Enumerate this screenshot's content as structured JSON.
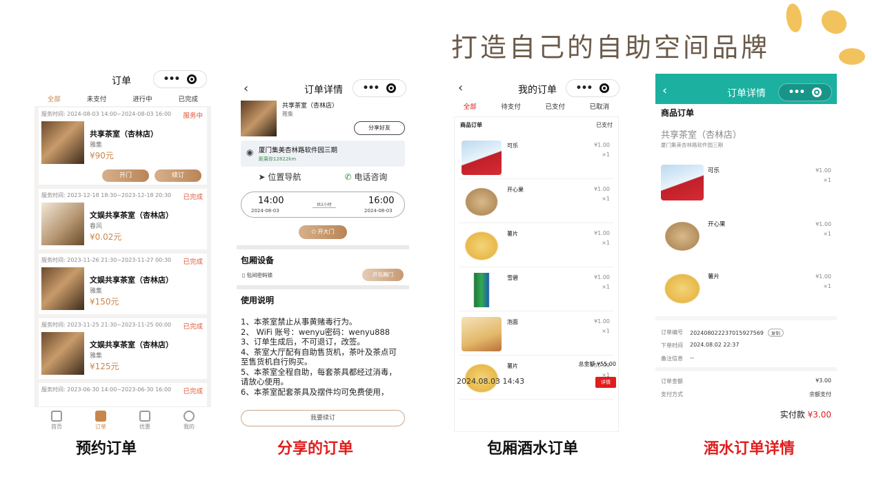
{
  "slogan": "打造自己的自助空间品牌",
  "captions": [
    "预约订单",
    "分享的订单",
    "包厢酒水订单",
    "酒水订单详情"
  ],
  "accent_colors": {
    "brand_gold": "#c8864c",
    "red": "#e11d1d",
    "teal": "#1bb0a0"
  },
  "screen1": {
    "title": "订单",
    "tabs": [
      "全部",
      "未支付",
      "进行中",
      "已完成"
    ],
    "orders": [
      {
        "time": "服务时间: 2024-08-03 14:00~2024-08-03 16:00",
        "status": "服务中",
        "name": "共享茶室（杏林店）",
        "room": "雅集",
        "price": "¥90元",
        "buttons": [
          "开门",
          "续订"
        ]
      },
      {
        "time": "服务时间: 2023-12-18 18:30~2023-12-18 20:30",
        "status": "已完成",
        "name": "文娱共享茶室（杏林店）",
        "room": "春风",
        "price": "¥0.02元"
      },
      {
        "time": "服务时间: 2023-11-26 21:30~2023-11-27 00:30",
        "status": "已完成",
        "name": "文娱共享茶室（杏林店）",
        "room": "雅集",
        "price": "¥150元"
      },
      {
        "time": "服务时间: 2023-11-25 21:30~2023-11-25 00:00",
        "status": "已完成",
        "name": "文娱共享茶室（杏林店）",
        "room": "雅集",
        "price": "¥125元"
      },
      {
        "time": "服务时间: 2023-06-30 14:00~2023-06-30 16:00",
        "status": "已完成"
      }
    ],
    "tabbar": [
      "首页",
      "订单",
      "优惠",
      "我的"
    ]
  },
  "screen2": {
    "title": "订单详情",
    "store_name": "共享茶室（杏林店）",
    "room": "雅集",
    "share_label": "分享好友",
    "address": "厦门集美杏林路软件园三期",
    "distance": "距离你12822km",
    "nav_label": "位置导航",
    "phone_label": "电话咨询",
    "start_time": "14:00",
    "start_date": "2024-08-03",
    "duration": "共2小时",
    "end_time": "16:00",
    "end_date": "2024-08-03",
    "open_door": "开大门",
    "device_title": "包厢设备",
    "lock_label": "包间密码锁",
    "lock_button": "开包厢门",
    "rules_title": "使用说明",
    "rules": [
      "1、本茶室禁止从事黄赌毒行为。",
      "2、 WiFi 账号：wenyu密码：wenyu888",
      "3、订单生成后，不可退订，改签。",
      "4、茶室大厅配有自助售货机，茶叶及茶点可至售货机自行购买。",
      "5、本茶室全程自助，每套茶具都经过消毒，请放心使用。",
      "6、本茶室配套茶具及摆件均可免费使用，"
    ],
    "renew": "我要续订"
  },
  "screen3": {
    "title": "我的订单",
    "tabs": [
      "全部",
      "待支付",
      "已支付",
      "已取消"
    ],
    "section": "商品订单",
    "section_status": "已支付",
    "items": [
      {
        "name": "可乐",
        "price": "¥1.00",
        "qty": "×1",
        "img": "cola"
      },
      {
        "name": "开心果",
        "price": "¥1.00",
        "qty": "×1",
        "img": "pist"
      },
      {
        "name": "薯片",
        "price": "¥1.00",
        "qty": "×1",
        "img": "chip"
      },
      {
        "name": "雪碧",
        "price": "¥1.00",
        "qty": "×1",
        "img": "can"
      },
      {
        "name": "泡面",
        "price": "¥1.00",
        "qty": "×1",
        "img": "noodle"
      },
      {
        "name": "薯片",
        "price": "¥50.00",
        "qty": "×1",
        "img": "chip"
      }
    ],
    "total": "总金额 ¥55.00",
    "date": "2024.08.03 14:43",
    "detail": "详情"
  },
  "screen4": {
    "title": "订单详情",
    "section": "商品订单",
    "store_name": "共享茶室（杏林店）",
    "store_address": "厦门集美杏林路软件园三期",
    "items": [
      {
        "name": "可乐",
        "price": "¥1.00",
        "qty": "×1",
        "img": "cola"
      },
      {
        "name": "开心果",
        "price": "¥1.00",
        "qty": "×1",
        "img": "pist"
      },
      {
        "name": "薯片",
        "price": "¥1.00",
        "qty": "×1",
        "img": "chip"
      }
    ],
    "order_no_label": "订单编号",
    "order_no": "2024080222370159275​69",
    "copy": "复制",
    "order_time_label": "下单时间",
    "order_time": "2024.08.02 22:37",
    "note_label": "备注信息",
    "note": "--",
    "amount_label": "订单金额",
    "amount": "¥3.00",
    "pay_label": "支付方式",
    "pay_method": "余额支付",
    "paid_label": "实付款",
    "paid": "¥3.00"
  }
}
